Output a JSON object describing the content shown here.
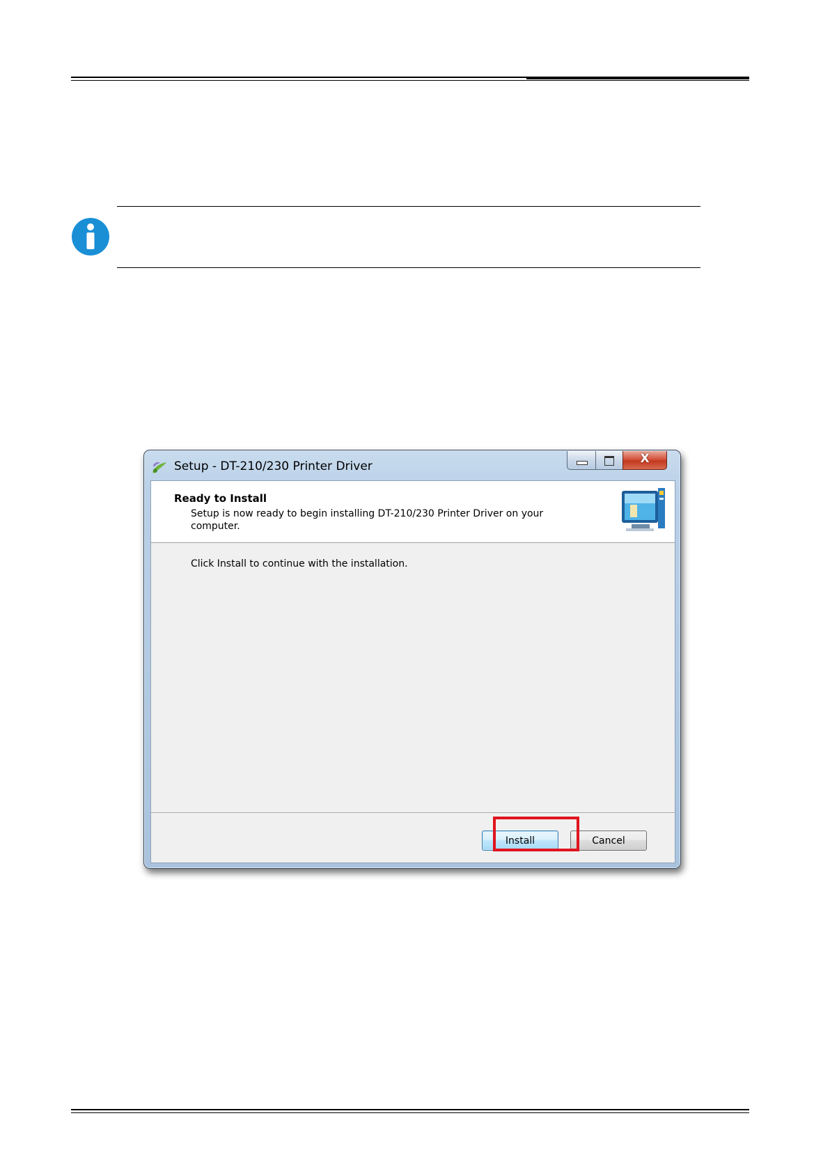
{
  "window": {
    "title": "Setup - DT-210/230 Printer Driver",
    "close_glyph": "X"
  },
  "header": {
    "title": "Ready to Install",
    "description": "Setup is now ready to begin installing DT-210/230 Printer Driver on your computer."
  },
  "body": {
    "instruction": "Click Install to continue with the installation."
  },
  "buttons": {
    "install": "Install",
    "cancel": "Cancel"
  },
  "icons": {
    "note": "info-icon",
    "title": "setup-app-icon",
    "header": "monitor-icon"
  },
  "colors": {
    "highlight": "#e0141e",
    "info_icon": "#1a8fd6",
    "close_button": "#c23a20"
  }
}
